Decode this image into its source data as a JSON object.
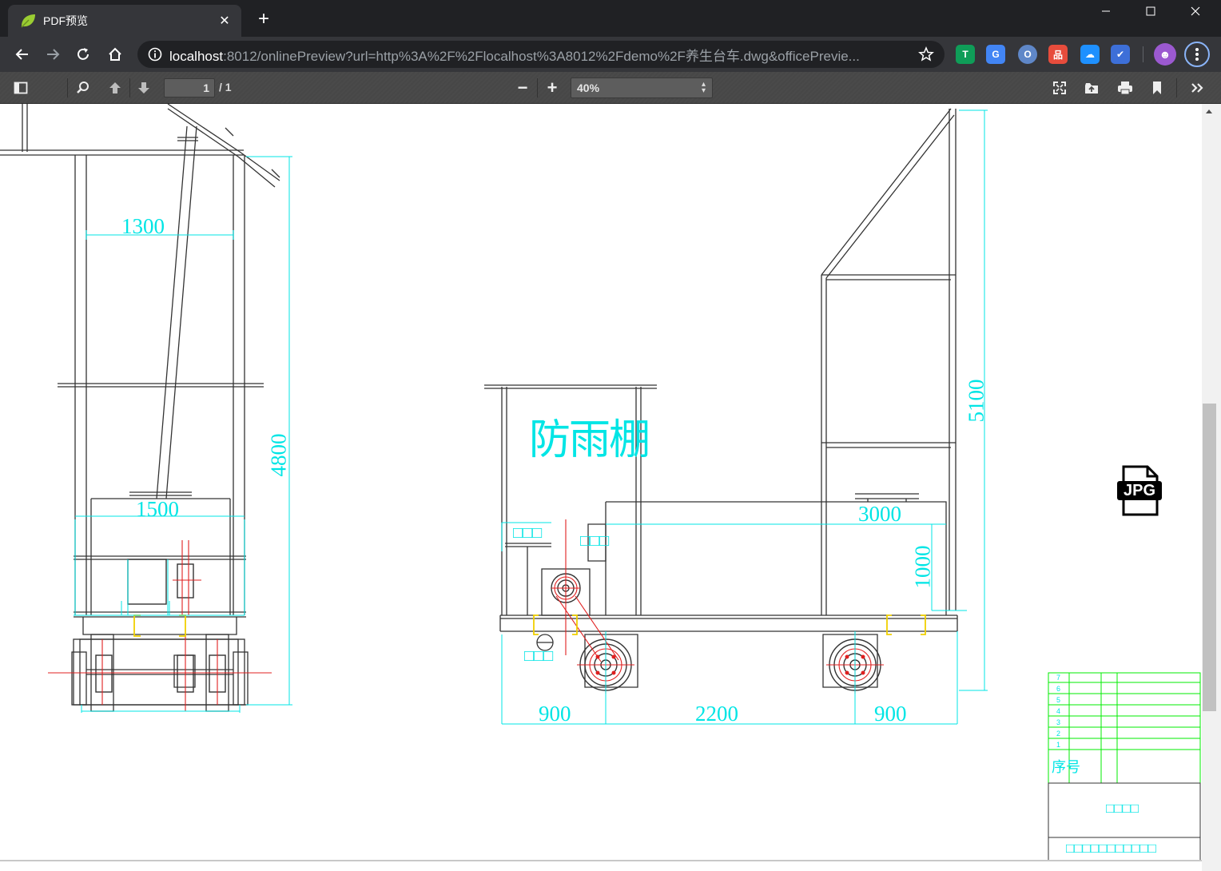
{
  "browser": {
    "tab": {
      "title": "PDF预览",
      "close": "✕"
    },
    "new_tab": "+",
    "window": {
      "minimize": "—",
      "maximize": "☐",
      "close": "✕"
    },
    "address": {
      "host": "localhost",
      "rest": ":8012/onlinePreview?url=http%3A%2F%2Flocalhost%3A8012%2Fdemo%2F养生台车.dwg&officePrevie..."
    },
    "extensions": [
      {
        "name": "ext-tampermonkey",
        "glyph": "T",
        "color": "#0f9d58"
      },
      {
        "name": "ext-translate",
        "glyph": "G",
        "color": "#4285f4"
      },
      {
        "name": "ext-circle",
        "glyph": "O",
        "color": "#5f87c8"
      },
      {
        "name": "ext-house",
        "glyph": "品",
        "color": "#e74c3c"
      },
      {
        "name": "ext-cloud",
        "glyph": "☁",
        "color": "#1e90ff"
      },
      {
        "name": "ext-arrow",
        "glyph": "✔",
        "color": "#3d6fd8"
      }
    ],
    "avatar": "☻"
  },
  "pdf_toolbar": {
    "page_number": "1",
    "page_count": "/ 1",
    "zoom_minus": "−",
    "zoom_plus": "+",
    "zoom_value": "40%"
  },
  "drawing": {
    "colors": {
      "line": "#333333",
      "dim": "#00e5e5",
      "red": "#e02020",
      "yellow": "#f0d000",
      "green": "#00ee00"
    },
    "dims_left": {
      "width_top": "1300",
      "width_box": "1500",
      "height": "4800"
    },
    "dims_right": {
      "title": "防雨棚",
      "height_total": "5100",
      "tank_width": "3000",
      "tank_height": "1000",
      "span_left": "900",
      "span_mid": "2200",
      "span_right": "900",
      "label_a": "□□□",
      "label_b": "□□□",
      "label_c": "□□□"
    },
    "title_block": {
      "header": "序号",
      "rows": [
        "7",
        "6",
        "5",
        "4",
        "3",
        "2",
        "1"
      ],
      "caption1": "□□□□",
      "caption2": "□□□□□□□□□□□"
    },
    "jpg_badge": "JPG"
  }
}
